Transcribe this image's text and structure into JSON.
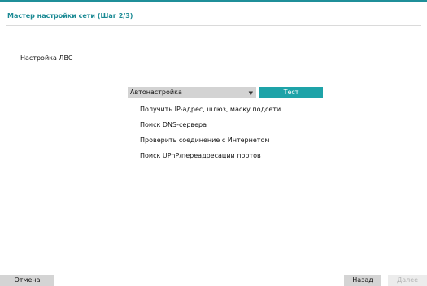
{
  "wizard": {
    "title": "Мастер настройки сети (Шаг 2/3)"
  },
  "section": {
    "title": "Настройка ЛВС"
  },
  "mode_select": {
    "value": "Автонастройка",
    "arrow": "▼"
  },
  "test_button": {
    "label": "Тест"
  },
  "steps": [
    "Получить IP-адрес, шлюз, маску подсети",
    "Поиск DNS-сервера",
    "Проверить соединение с Интернетом",
    "Поиск UPnP/переадресации портов"
  ],
  "footer": {
    "cancel": "Отмена",
    "back": "Назад",
    "next": "Далее"
  },
  "colors": {
    "accent": "#1ea3a8",
    "title": "#1b8a94",
    "button_bg": "#d4d4d4",
    "disabled_text": "#b3b3b3"
  }
}
